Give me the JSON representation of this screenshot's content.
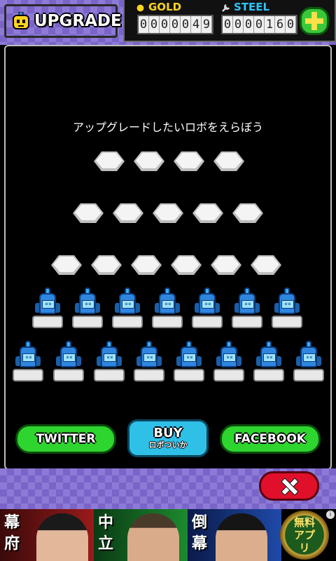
{
  "header": {
    "title": "UPGRADE",
    "gold_label": "GOLD",
    "gold_digits": [
      "0",
      "0",
      "0",
      "0",
      "0",
      "4",
      "9"
    ],
    "steel_label": "STEEL",
    "steel_digits": [
      "0",
      "0",
      "0",
      "0",
      "1",
      "6",
      "0"
    ]
  },
  "main": {
    "instruction": "アップグレードしたいロボをえらぼう",
    "robot_face_glyph": "××"
  },
  "buttons": {
    "twitter": "TWITTER",
    "buy": "BUY",
    "buy_sub": "ロボついか",
    "facebook": "FACEBOOK"
  },
  "ad": {
    "panel1": [
      "幕",
      "府"
    ],
    "panel2": [
      "中",
      "立"
    ],
    "panel3": [
      "倒",
      "幕"
    ],
    "badge": "無料アプリ",
    "info": "i"
  },
  "colors": {
    "gold": "#ffd21e",
    "steel": "#2fc3ff",
    "accent_green": "#2ed52e",
    "buy_blue": "#2fc0e8",
    "close_red": "#e0102a"
  }
}
